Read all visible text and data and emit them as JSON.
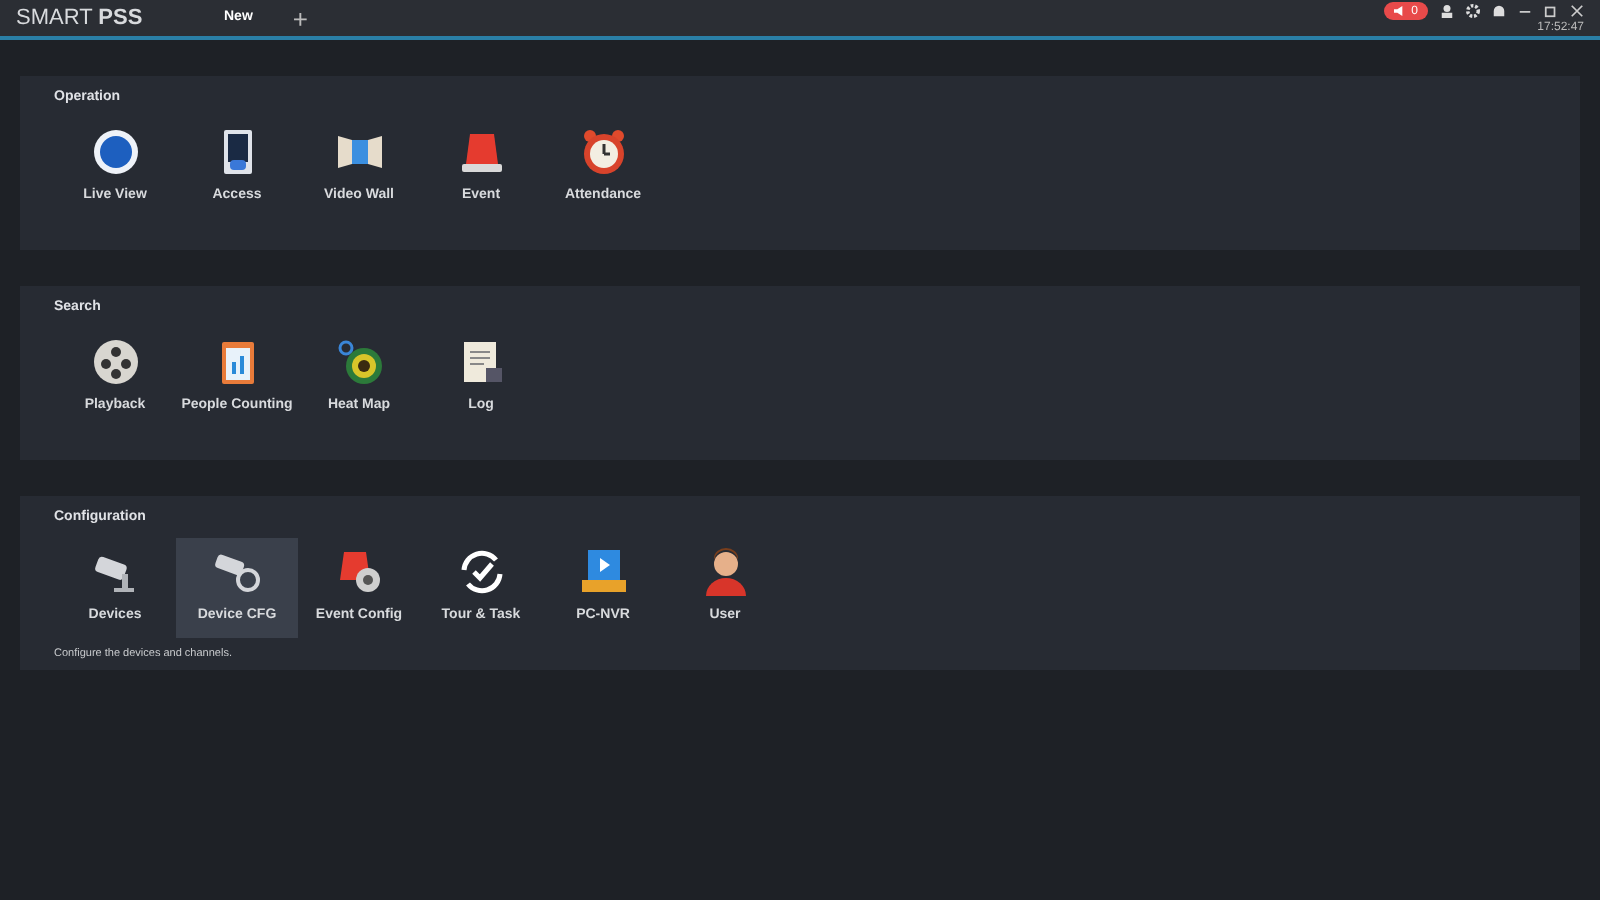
{
  "app": {
    "title_light": "SMART ",
    "title_bold": "PSS"
  },
  "tabs": [
    {
      "label": "New",
      "selected": true
    }
  ],
  "add_tab": "+",
  "alarm_count": "0",
  "clock": "17:52:47",
  "sections": [
    {
      "title": "Operation",
      "items": [
        {
          "label": "Live View",
          "selected": false
        },
        {
          "label": "Access",
          "selected": false
        },
        {
          "label": "Video Wall",
          "selected": false
        },
        {
          "label": "Event",
          "selected": false
        },
        {
          "label": "Attendance",
          "selected": false
        }
      ]
    },
    {
      "title": "Search",
      "items": [
        {
          "label": "Playback",
          "selected": false
        },
        {
          "label": "People Counting",
          "selected": false
        },
        {
          "label": "Heat Map",
          "selected": false
        },
        {
          "label": "Log",
          "selected": false
        }
      ]
    },
    {
      "title": "Configuration",
      "items": [
        {
          "label": "Devices",
          "selected": false
        },
        {
          "label": "Device CFG",
          "selected": true
        },
        {
          "label": "Event Config",
          "selected": false
        },
        {
          "label": "Tour & Task",
          "selected": false
        },
        {
          "label": "PC-NVR",
          "selected": false
        },
        {
          "label": "User",
          "selected": false
        }
      ],
      "description": "Configure the devices and channels."
    }
  ]
}
